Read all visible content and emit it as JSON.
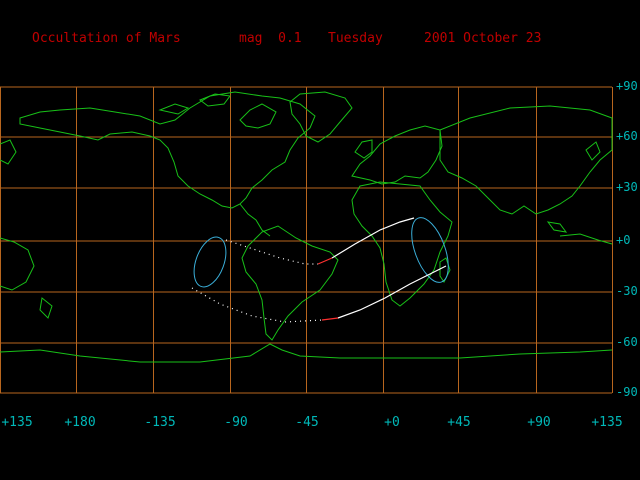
{
  "header": {
    "title": "Occultation of Mars",
    "magnitude": "mag  0.1",
    "weekday": "Tuesday",
    "date": "2001 October 23"
  },
  "lat_labels": [
    "+90",
    "+60",
    "+30",
    "+0",
    "-30",
    "-60",
    "-90"
  ],
  "lon_labels": [
    "+135",
    "+180",
    "-135",
    "-90",
    "-45",
    "+0",
    "+45",
    "+90",
    "+135"
  ],
  "colors": {
    "grid": "#b8661e",
    "coast": "#18c018",
    "label": "#00b8b8",
    "title": "#c00000",
    "path": "#ffffff",
    "limit_circle": "#3aaed8",
    "path_start": "#ff3030"
  }
}
